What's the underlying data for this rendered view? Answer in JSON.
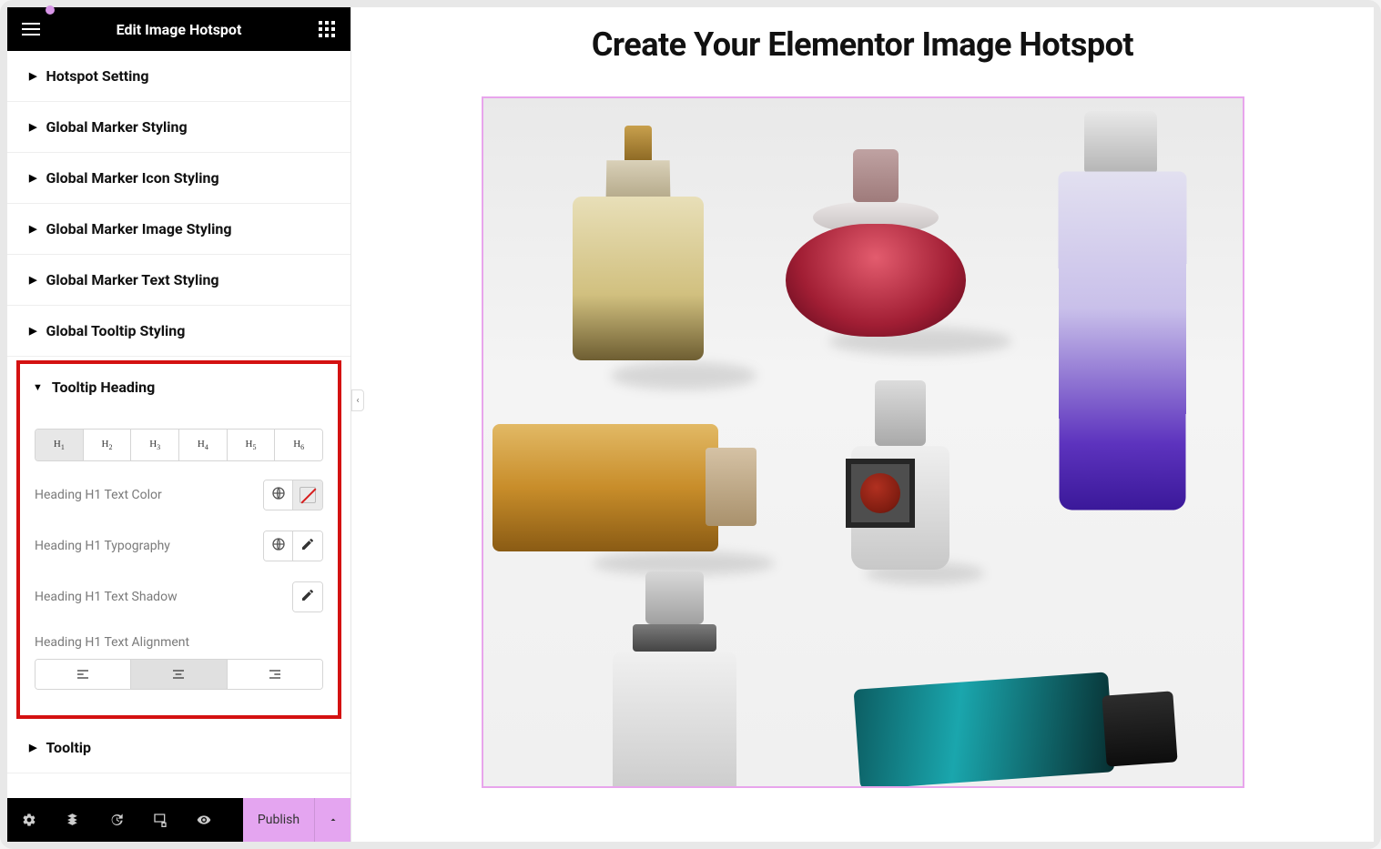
{
  "header": {
    "title": "Edit Image Hotspot"
  },
  "sections": {
    "hotspot_setting": "Hotspot Setting",
    "global_marker_styling": "Global Marker Styling",
    "global_marker_icon": "Global Marker Icon Styling",
    "global_marker_image": "Global Marker Image Styling",
    "global_marker_text": "Global Marker Text Styling",
    "global_tooltip": "Global Tooltip Styling",
    "tooltip_heading": "Tooltip Heading",
    "tooltip": "Tooltip"
  },
  "heading_tabs": [
    "H1",
    "H2",
    "H3",
    "H4",
    "H5",
    "H6"
  ],
  "active_tab": "H1",
  "controls": {
    "text_color": "Heading H1 Text Color",
    "typography": "Heading H1 Typography",
    "text_shadow": "Heading H1 Text Shadow",
    "alignment": "Heading H1 Text Alignment"
  },
  "alignment_active": "center",
  "footer": {
    "publish": "Publish"
  },
  "canvas": {
    "page_title": "Create Your Elementor Image Hotspot"
  },
  "colors": {
    "highlight_border": "#d41111",
    "accent": "#e4a5f0",
    "frame_border": "#e8a5ec"
  }
}
